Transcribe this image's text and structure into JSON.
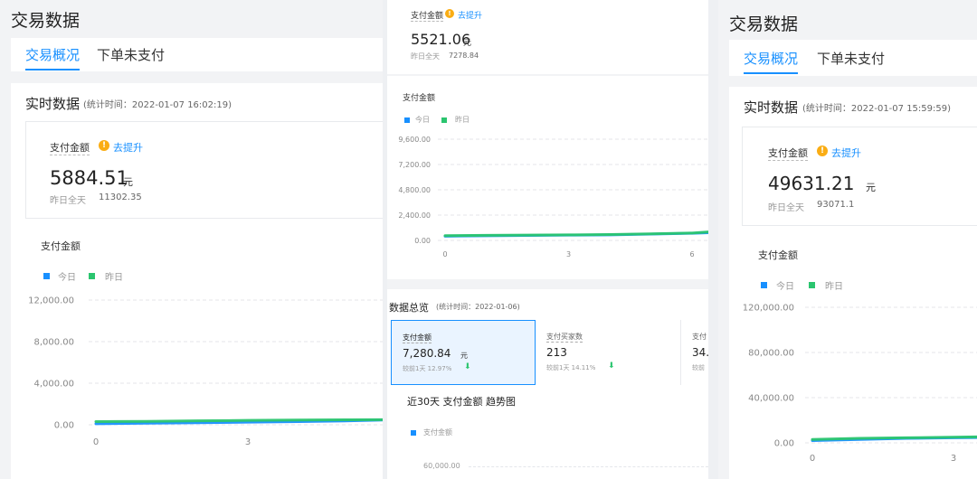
{
  "colors": {
    "accent": "#1890ff",
    "today": "#1890ff",
    "yesterday": "#2bc56f",
    "warn": "#faad14",
    "down": "#2bc56f"
  },
  "left": {
    "title": "交易数据",
    "tabs": [
      {
        "label": "交易概况"
      },
      {
        "label": "下单未支付"
      }
    ],
    "realtime_title": "实时数据",
    "realtime_time": "(统计时间：2022-01-07 16:02:19)",
    "metric_label": "支付金额",
    "metric_link": "去提升",
    "metric_value": "5884.51",
    "metric_unit": "元",
    "yesterday_label": "昨日全天",
    "yesterday_value": "11302.35",
    "chart_title": "支付金额",
    "legend": [
      "今日",
      "昨日"
    ]
  },
  "middle": {
    "metric_label": "支付金额",
    "metric_link": "去提升",
    "metric_value": "5521.06",
    "metric_unit": "元",
    "yesterday_label": "昨日全天",
    "yesterday_value": "7278.84",
    "chart_title": "支付金额",
    "legend": [
      "今日",
      "昨日"
    ],
    "overview_title": "数据总览",
    "overview_time": "(统计时间：2022-01-06)",
    "overview_cards": [
      {
        "label": "支付金额",
        "value": "7,280.84",
        "unit": "元",
        "compare": "较前1天 12.97%"
      },
      {
        "label": "支付买家数",
        "value": "213",
        "unit": "",
        "compare": "较前1天 14.11%"
      },
      {
        "label": "支付",
        "value": "34.",
        "unit": "",
        "compare": "较前"
      }
    ],
    "trend_title": "近30天 支付金额 趋势图",
    "trend_legend": "支付金额",
    "trend_ytick": "60,000.00"
  },
  "right": {
    "title": "交易数据",
    "tabs": [
      {
        "label": "交易概况"
      },
      {
        "label": "下单未支付"
      }
    ],
    "realtime_title": "实时数据",
    "realtime_time": "(统计时间：2022-01-07 15:59:59)",
    "metric_label": "支付金额",
    "metric_link": "去提升",
    "metric_value": "49631.21",
    "metric_unit": "元",
    "yesterday_label": "昨日全天",
    "yesterday_value": "93071.1",
    "chart_title": "支付金额",
    "legend": [
      "今日",
      "昨日"
    ]
  },
  "chart_data": [
    {
      "type": "line",
      "title": "支付金额",
      "yticks": [
        "12,000.00",
        "8,000.00",
        "4,000.00",
        "0.00"
      ],
      "xticks": [
        "0",
        "3"
      ],
      "ylim": [
        0,
        12000
      ],
      "series": [
        {
          "name": "今日",
          "x": [
            0,
            1,
            2,
            3,
            4,
            5,
            6,
            7,
            8
          ],
          "y": [
            100,
            150,
            200,
            250,
            300,
            380,
            500,
            600,
            900
          ]
        },
        {
          "name": "昨日",
          "x": [
            0,
            1,
            2,
            3,
            4,
            5,
            6,
            7,
            8
          ],
          "y": [
            300,
            330,
            380,
            420,
            460,
            480,
            500,
            650,
            950
          ]
        }
      ]
    },
    {
      "type": "line",
      "title": "支付金额",
      "yticks": [
        "9,600.00",
        "7,200.00",
        "4,800.00",
        "2,400.00",
        "0.00"
      ],
      "xticks": [
        "0",
        "3",
        "6"
      ],
      "ylim": [
        0,
        9600
      ],
      "series": [
        {
          "name": "今日",
          "x": [
            0,
            1,
            2,
            3,
            4,
            5,
            6,
            7
          ],
          "y": [
            400,
            440,
            470,
            500,
            530,
            600,
            680,
            800
          ]
        },
        {
          "name": "昨日",
          "x": [
            0,
            1,
            2,
            3,
            4,
            5,
            6,
            7
          ],
          "y": [
            450,
            480,
            500,
            520,
            560,
            620,
            700,
            950
          ]
        }
      ]
    },
    {
      "type": "line",
      "title": "支付金额",
      "yticks": [
        "120,000.00",
        "80,000.00",
        "40,000.00",
        "0.00"
      ],
      "xticks": [
        "0",
        "3"
      ],
      "ylim": [
        0,
        120000
      ],
      "series": [
        {
          "name": "今日",
          "x": [
            0,
            1,
            2,
            3,
            4,
            5,
            6
          ],
          "y": [
            2000,
            3000,
            4000,
            4500,
            5000,
            5800,
            6500
          ]
        },
        {
          "name": "昨日",
          "x": [
            0,
            1,
            2,
            3,
            4,
            5,
            6
          ],
          "y": [
            3000,
            4000,
            4500,
            5000,
            5500,
            6200,
            7000
          ]
        }
      ]
    }
  ]
}
